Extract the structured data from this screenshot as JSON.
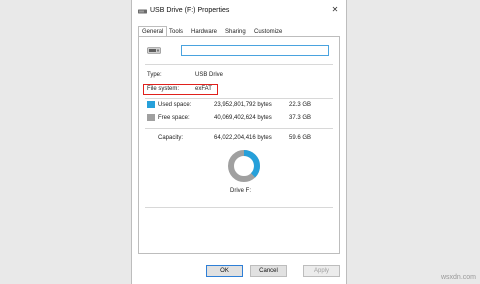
{
  "window": {
    "title": "USB Drive (F:) Properties",
    "close_glyph": "✕"
  },
  "tabs": [
    {
      "label": "General",
      "active": true
    },
    {
      "label": "Tools"
    },
    {
      "label": "Hardware"
    },
    {
      "label": "Sharing"
    },
    {
      "label": "Customize"
    }
  ],
  "general": {
    "name_value": "",
    "type_label": "Type:",
    "type_value": "USB Drive",
    "fs_label": "File system:",
    "fs_value": "exFAT",
    "used_label": "Used space:",
    "used_bytes": "23,952,801,792 bytes",
    "used_gb": "22.3 GB",
    "free_label": "Free space:",
    "free_bytes": "40,069,402,624 bytes",
    "free_gb": "37.3 GB",
    "capacity_label": "Capacity:",
    "capacity_bytes": "64,022,204,416 bytes",
    "capacity_gb": "59.6 GB",
    "drive_caption": "Drive F:",
    "used_fraction": 0.374
  },
  "colors": {
    "used": "#26a0da",
    "free": "#a0a0a0",
    "highlight": "#e0201c"
  },
  "buttons": {
    "ok": "OK",
    "cancel": "Cancel",
    "apply": "Apply"
  },
  "watermark": "wsxdn.com"
}
